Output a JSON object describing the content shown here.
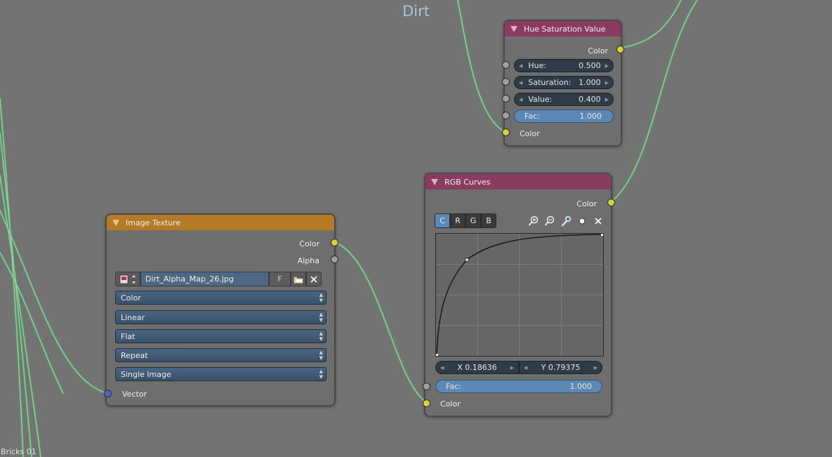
{
  "editor": {
    "title": "Dirt",
    "tree_name": "Bricks 01"
  },
  "colors": {
    "socket_color": "#d4d239",
    "socket_float": "#a0a0a0",
    "socket_vector": "#5b5bd0",
    "link": "#7fbf8a",
    "header_texture": "#b57a25",
    "header_color": "#8b3b5f"
  },
  "hsv_node": {
    "title": "Hue Saturation Value",
    "output_color": "Color",
    "fields": [
      {
        "label": "Hue:",
        "value": "0.500"
      },
      {
        "label": "Saturation:",
        "value": "1.000"
      },
      {
        "label": "Value:",
        "value": "0.400"
      }
    ],
    "fac_label": "Fac:",
    "fac_value": "1.000",
    "input_color": "Color"
  },
  "rgb_curves": {
    "title": "RGB Curves",
    "output_color": "Color",
    "tabs": [
      "C",
      "R",
      "G",
      "B"
    ],
    "active_tab": "C",
    "icons": [
      "zoom-in-icon",
      "zoom-out-icon",
      "wrench-icon",
      "dot-icon",
      "close-icon"
    ],
    "x_value": "X 0.18636",
    "y_value": "Y 0.79375",
    "fac_label": "Fac:",
    "fac_value": "1.000",
    "input_color": "Color"
  },
  "image_texture": {
    "title": "Image Texture",
    "output_color": "Color",
    "output_alpha": "Alpha",
    "image_name": "Dirt_Alpha_Map_26.jpg",
    "fake_user": "F",
    "dropdowns": [
      "Color",
      "Linear",
      "Flat",
      "Repeat",
      "Single Image"
    ],
    "input_vector": "Vector"
  }
}
